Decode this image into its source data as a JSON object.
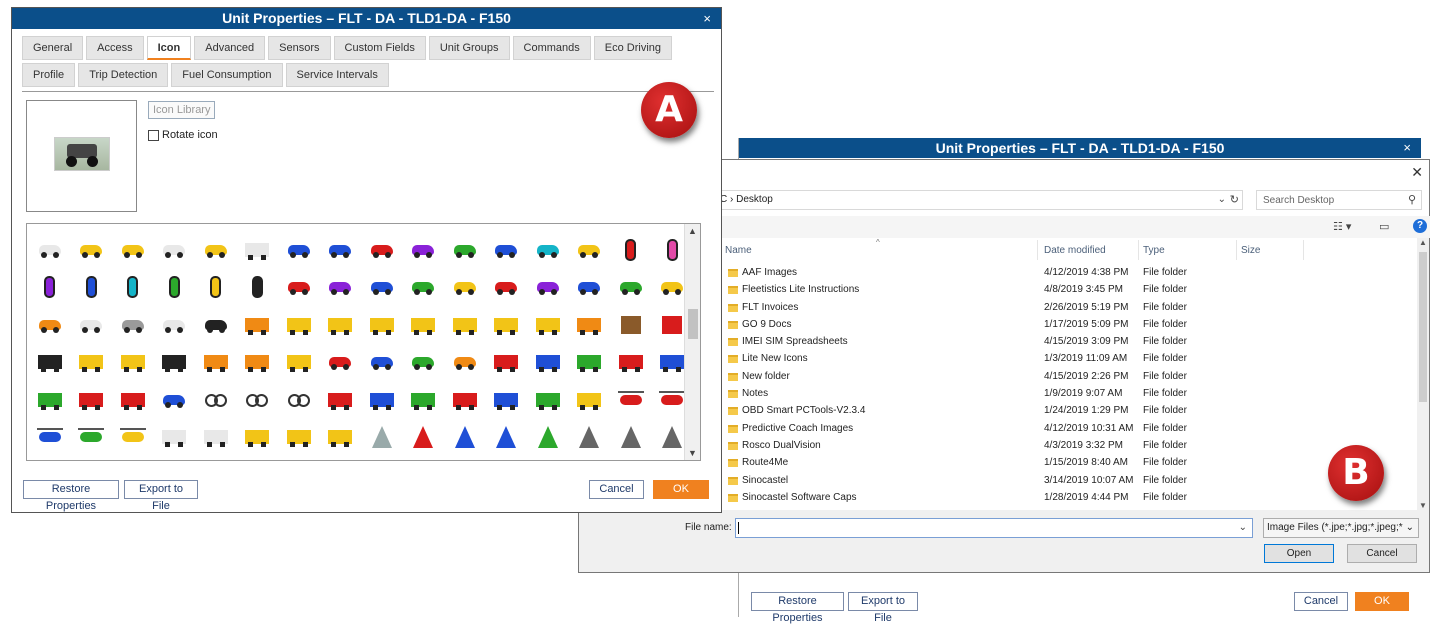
{
  "dialog_a": {
    "title": "Unit Properties – FLT - DA - TLD1-DA - F150",
    "tabs_row1": [
      "General",
      "Access",
      "Icon",
      "Advanced",
      "Sensors",
      "Custom Fields",
      "Unit Groups",
      "Commands",
      "Eco Driving"
    ],
    "tabs_row2": [
      "Profile",
      "Trip Detection",
      "Fuel Consumption",
      "Service Intervals"
    ],
    "active_tab": "Icon",
    "icon_library_label": "Icon Library",
    "rotate_icon_label": "Rotate icon",
    "restore_label": "Restore Properties",
    "export_label": "Export to File",
    "cancel_label": "Cancel",
    "ok_label": "OK",
    "icon_grid": [
      [
        "car-white",
        "car-yellow",
        "car-yellow",
        "car-white",
        "car-yellow",
        "truck-white",
        "car-blue",
        "car-blue",
        "car-red",
        "car-purple",
        "car-green",
        "car-blue",
        "car-cyan",
        "car-yellow",
        "vcar-red",
        "vcar-pink"
      ],
      [
        "vcar-purple",
        "vcar-blue",
        "vcar-cyan",
        "vcar-green",
        "vcar-yellow",
        "vcar-black",
        "car-red",
        "car-purple",
        "car-blue",
        "car-green",
        "car-yellow",
        "car-red",
        "car-purple",
        "car-blue",
        "car-green",
        "car-yellow"
      ],
      [
        "car-orange",
        "car-white",
        "car-gray",
        "car-white",
        "car-black",
        "dozer-orange",
        "loader-yellow",
        "grader-yellow",
        "dozer-yellow",
        "loader-yellow",
        "crane-yellow",
        "truck-yellow",
        "truck-yellow",
        "truck-orange",
        "box-brown",
        "box-red"
      ],
      [
        "forklift-black",
        "roller-yellow",
        "roller-yellow",
        "forklift-black",
        "mixer-orange",
        "excavator-orange",
        "crane-yellow",
        "car-red",
        "car-blue",
        "car-green",
        "car-orange",
        "tractor-red",
        "tractor-blue",
        "tractor-green",
        "tractor-red",
        "tractor-blue"
      ],
      [
        "tractor-green",
        "truck-red",
        "truck-red",
        "car-blue",
        "bike-red",
        "bike-blue",
        "bike-green",
        "moto-red",
        "moto-blue",
        "moto-green",
        "atv-red",
        "atv-blue",
        "atv-green",
        "jet-yellow",
        "heli-red",
        "heli-red"
      ],
      [
        "heli-blue",
        "heli-green",
        "heli-yellow",
        "plane-white",
        "plane-white",
        "grader-yellow",
        "roller-yellow",
        "truck-yellow",
        "boat-white",
        "boat-red",
        "boat-blue",
        "boat-blue",
        "boat-green",
        "ship-gray",
        "ship-gray",
        "ship-gray",
        "container-red"
      ]
    ]
  },
  "dialog_b": {
    "title": "Unit Properties – FLT - DA - TLD1-DA - F150",
    "restore_label": "Restore Properties",
    "export_label": "Export to File",
    "cancel_label": "Cancel",
    "ok_label": "OK"
  },
  "file_dialog": {
    "path_prefix": "C",
    "path_sep": "›",
    "path_folder": "Desktop",
    "search_placeholder": "Search Desktop",
    "columns": {
      "name": "Name",
      "date": "Date modified",
      "type": "Type",
      "size": "Size"
    },
    "rows": [
      {
        "name": "AAF Images",
        "date": "4/12/2019 4:38 PM",
        "type": "File folder"
      },
      {
        "name": "Fleetistics Lite Instructions",
        "date": "4/8/2019 3:45 PM",
        "type": "File folder"
      },
      {
        "name": "FLT Invoices",
        "date": "2/26/2019 5:19 PM",
        "type": "File folder"
      },
      {
        "name": "GO 9 Docs",
        "date": "1/17/2019 5:09 PM",
        "type": "File folder"
      },
      {
        "name": "IMEI SIM Spreadsheets",
        "date": "4/15/2019 3:09 PM",
        "type": "File folder"
      },
      {
        "name": "Lite New Icons",
        "date": "1/3/2019 11:09 AM",
        "type": "File folder"
      },
      {
        "name": "New folder",
        "date": "4/15/2019 2:26 PM",
        "type": "File folder"
      },
      {
        "name": "Notes",
        "date": "1/9/2019 9:07 AM",
        "type": "File folder"
      },
      {
        "name": "OBD Smart PCTools-V2.3.4",
        "date": "1/24/2019 1:29 PM",
        "type": "File folder"
      },
      {
        "name": "Predictive Coach Images",
        "date": "4/12/2019 10:31 AM",
        "type": "File folder"
      },
      {
        "name": "Rosco DualVision",
        "date": "4/3/2019 3:32 PM",
        "type": "File folder"
      },
      {
        "name": "Route4Me",
        "date": "1/15/2019 8:40 AM",
        "type": "File folder"
      },
      {
        "name": "Sinocastel",
        "date": "3/14/2019 10:07 AM",
        "type": "File folder"
      },
      {
        "name": "Sinocastel Software Caps",
        "date": "1/28/2019 4:44 PM",
        "type": "File folder"
      }
    ],
    "file_name_label": "File name:",
    "file_name_value": "",
    "file_type_value": "Image Files (*.jpe;*.jpg;*.jpeg;*.",
    "open_label": "Open",
    "cancel_label": "Cancel"
  },
  "badges": {
    "a": "A",
    "b": "B"
  },
  "colors": {
    "titlebar": "#0b4f8a",
    "accent": "#f0811f",
    "badge": "#c0181b"
  }
}
